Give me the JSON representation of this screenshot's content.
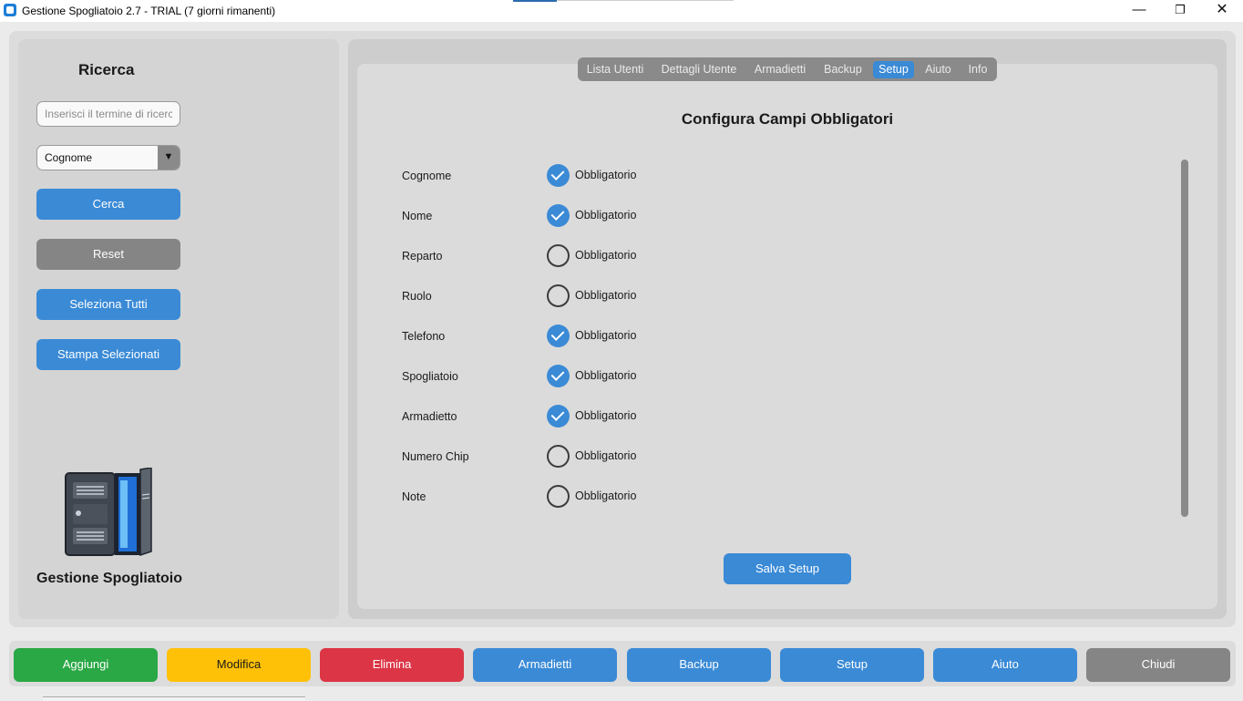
{
  "window": {
    "title": "Gestione Spogliatoio 2.7 - TRIAL (7 giorni rimanenti)",
    "minimize": "—",
    "maximize": "❐",
    "close": "✕"
  },
  "sidebar": {
    "title": "Ricerca",
    "search_placeholder": "Inserisci il termine di ricerca",
    "search_value": "",
    "search_field": "Cognome",
    "buttons": {
      "search": "Cerca",
      "reset": "Reset",
      "select_all": "Seleziona Tutti",
      "print_selected": "Stampa Selezionati"
    },
    "brand": "Gestione Spogliatoio"
  },
  "tabs": [
    {
      "label": "Lista Utenti",
      "active": false
    },
    {
      "label": "Dettagli Utente",
      "active": false
    },
    {
      "label": "Armadietti",
      "active": false
    },
    {
      "label": "Backup",
      "active": false
    },
    {
      "label": "Setup",
      "active": true
    },
    {
      "label": "Aiuto",
      "active": false
    },
    {
      "label": "Info",
      "active": false
    }
  ],
  "setup": {
    "title": "Configura Campi Obbligatori",
    "checkbox_label": "Obbligatorio",
    "fields": [
      {
        "name": "Cognome",
        "required": true
      },
      {
        "name": "Nome",
        "required": true
      },
      {
        "name": "Reparto",
        "required": false
      },
      {
        "name": "Ruolo",
        "required": false
      },
      {
        "name": "Telefono",
        "required": true
      },
      {
        "name": "Spogliatoio",
        "required": true
      },
      {
        "name": "Armadietto",
        "required": true
      },
      {
        "name": "Numero Chip",
        "required": false
      },
      {
        "name": "Note",
        "required": false
      }
    ],
    "save_label": "Salva Setup"
  },
  "bottom_bar": {
    "add": "Aggiungi",
    "edit": "Modifica",
    "delete": "Elimina",
    "lockers": "Armadietti",
    "backup": "Backup",
    "setup": "Setup",
    "help": "Aiuto",
    "close": "Chiudi"
  },
  "colors": {
    "accent": "#3a8ad6",
    "add": "#2aa845",
    "edit": "#ffc107",
    "delete": "#dc3545",
    "neutral": "#858585"
  }
}
